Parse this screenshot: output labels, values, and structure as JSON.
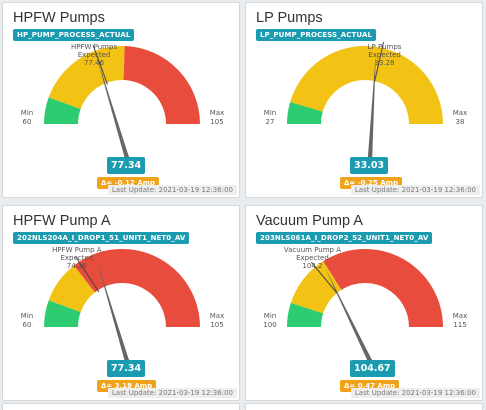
{
  "update_prefix": "Last Update: ",
  "colors": {
    "green": "#2ecc71",
    "yellow": "#f2c214",
    "red": "#e74c3c",
    "teal": "#1a9bb0",
    "orange": "#f0a21b",
    "needle": "#666666"
  },
  "cards": [
    {
      "title": "HPFW Pumps",
      "tag": "HP_PUMP_PROCESS_ACTUAL",
      "min": 60,
      "max": 105,
      "green_to": 65,
      "yellow_to": 83,
      "expected_label": "HPFW Pumps",
      "expected_word": "Expected",
      "expected": 77.46,
      "value": 77.34,
      "delta": "Δ= -0.12 Amp",
      "last_update": "2021-03-19 12:36:00"
    },
    {
      "title": "LP Pumps",
      "tag": "LP_PUMP_PROCESS_ACTUAL",
      "min": 27,
      "max": 38,
      "green_to": 28,
      "yellow_to": 38,
      "expected_label": "LP Pumps",
      "expected_word": "Expected",
      "expected": 33.28,
      "value": 33.03,
      "delta": "Δ= -0.25 Amp",
      "last_update": "2021-03-19 12:36:00"
    },
    {
      "title": "HPFW Pump A",
      "tag": "202NLS204A_I_DROP1_51_UNIT1_NET0_AV",
      "min": 60,
      "max": 105,
      "green_to": 65,
      "yellow_to": 73,
      "expected_label": "HPFW Pump A",
      "expected_word": "Expected",
      "expected": 74.16,
      "value": 77.34,
      "delta": "Δ= 3.18 Amp",
      "last_update": "2021-03-19 12:36:00"
    },
    {
      "title": "Vacuum Pump A",
      "tag": "203NLS061A_I_DROP2_52_UNIT1_NET0_AV",
      "min": 100,
      "max": 115,
      "green_to": 101.5,
      "yellow_to": 104.8,
      "expected_label": "Vacuum Pump A",
      "expected_word": "Expected",
      "expected": 104.2,
      "value": 104.67,
      "delta": "Δ= 0.47 Amp",
      "last_update": "2021-03-19 12:36:00"
    }
  ]
}
